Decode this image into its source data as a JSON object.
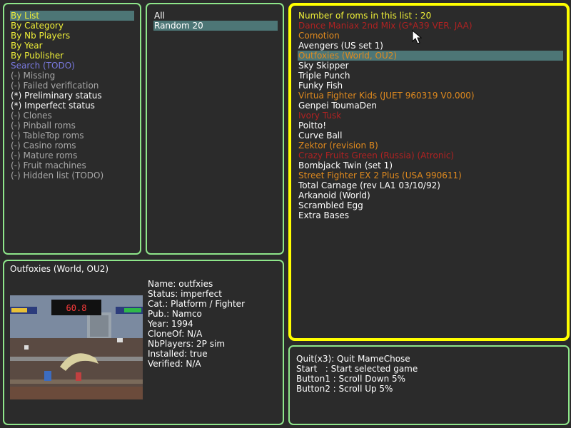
{
  "filters": {
    "items": [
      {
        "label": "By List",
        "color": "yellow",
        "selected": true
      },
      {
        "label": "By Category",
        "color": "yellow"
      },
      {
        "label": "By Nb Players",
        "color": "yellow"
      },
      {
        "label": "By Year",
        "color": "yellow"
      },
      {
        "label": "By Publisher",
        "color": "yellow"
      },
      {
        "label": "Search (TODO)",
        "color": "purple"
      },
      {
        "label": "(-) Missing",
        "color": "grey"
      },
      {
        "label": "(-) Failed verification",
        "color": "grey"
      },
      {
        "label": "(*) Preliminary status",
        "color": "white"
      },
      {
        "label": "(*) Imperfect status",
        "color": "white"
      },
      {
        "label": "(-) Clones",
        "color": "grey"
      },
      {
        "label": "(-) Pinball roms",
        "color": "grey"
      },
      {
        "label": "(-) TableTop roms",
        "color": "grey"
      },
      {
        "label": "(-) Casino roms",
        "color": "grey"
      },
      {
        "label": "(-) Mature roms",
        "color": "grey"
      },
      {
        "label": "(-) Fruit machines",
        "color": "grey"
      },
      {
        "label": "(-) Hidden list (TODO)",
        "color": "grey"
      }
    ]
  },
  "lists": {
    "items": [
      {
        "label": "All",
        "color": "white"
      },
      {
        "label": "Random 20",
        "color": "white",
        "selected": true
      }
    ]
  },
  "roms": {
    "header": "Number of roms in this list : 20",
    "items": [
      {
        "label": "Dance Maniax 2nd Mix (G*A39 VER. JAA)",
        "color": "red"
      },
      {
        "label": "Comotion",
        "color": "orange"
      },
      {
        "label": "Avengers (US set 1)",
        "color": "white"
      },
      {
        "label": "Outfoxies (World, OU2)",
        "color": "orange",
        "selected": true
      },
      {
        "label": "Sky Skipper",
        "color": "white"
      },
      {
        "label": "Triple Punch",
        "color": "white"
      },
      {
        "label": "Funky Fish",
        "color": "white"
      },
      {
        "label": "Virtua Fighter Kids (JUET 960319 V0.000)",
        "color": "orange"
      },
      {
        "label": "Genpei ToumaDen",
        "color": "white"
      },
      {
        "label": "Ivory Tusk",
        "color": "red"
      },
      {
        "label": "Poitto!",
        "color": "white"
      },
      {
        "label": "Curve Ball",
        "color": "white"
      },
      {
        "label": "Zektor (revision B)",
        "color": "orange"
      },
      {
        "label": "Crazy Fruits Green (Russia) (Atronic)",
        "color": "red"
      },
      {
        "label": "Bombjack Twin (set 1)",
        "color": "white"
      },
      {
        "label": "Street Fighter EX 2 Plus (USA 990611)",
        "color": "orange"
      },
      {
        "label": "Total Carnage (rev LA1 03/10/92)",
        "color": "white"
      },
      {
        "label": "Arkanoid (World)",
        "color": "white"
      },
      {
        "label": "Scrambled Egg",
        "color": "white"
      },
      {
        "label": "Extra Bases",
        "color": "white"
      }
    ]
  },
  "info": {
    "title": "Outfoxies (World, OU2)",
    "snapshot_timer": "60.8",
    "fields": [
      "Name: outfxies",
      "Status: imperfect",
      "Cat.: Platform / Fighter",
      "Pub.: Namco",
      "Year: 1994",
      "CloneOf: N/A",
      "NbPlayers: 2P sim",
      "Installed: true",
      "Verified: N/A"
    ]
  },
  "help": {
    "lines": [
      "Quit(x3): Quit MameChose",
      "Start   : Start selected game",
      "Button1 : Scroll Down 5%",
      "Button2 : Scroll Up 5%"
    ]
  },
  "colors": {
    "panel_border": "#8ee68a",
    "active_border": "#ffff00",
    "selection": "#4d7676",
    "background": "#2b2b2b"
  },
  "icons": {
    "pointer": "mouse-pointer-icon"
  }
}
